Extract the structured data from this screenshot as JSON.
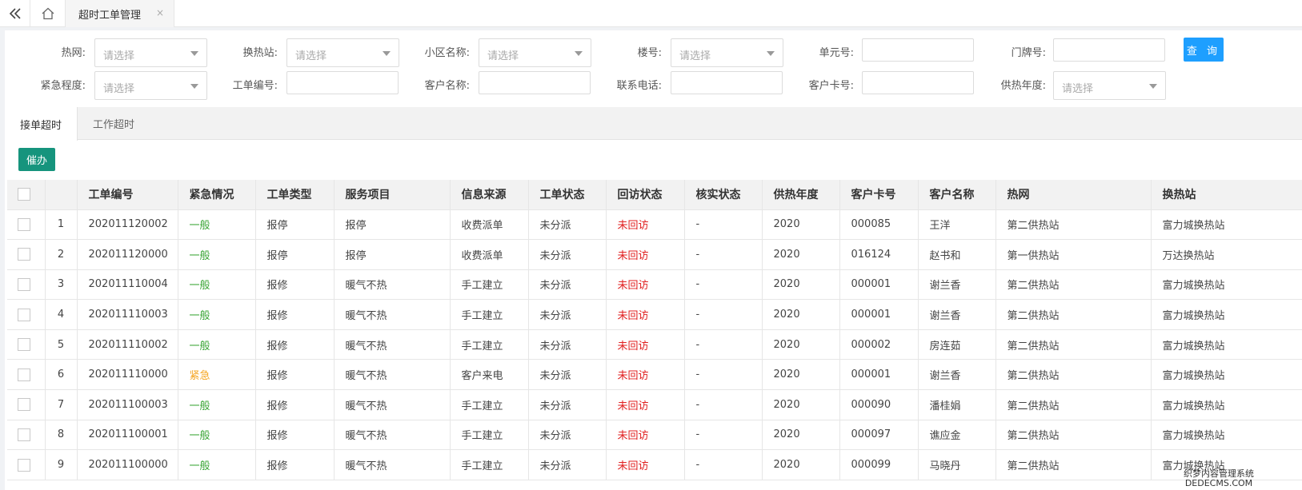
{
  "topbar": {
    "tab_label": "超时工单管理",
    "close_glyph": "×"
  },
  "filters": {
    "heat_net_label": "热网:",
    "station_label": "换热站:",
    "community_label": "小区名称:",
    "building_label": "楼号:",
    "unit_label": "单元号:",
    "door_label": "门牌号:",
    "urgency_label": "紧急程度:",
    "order_no_label": "工单编号:",
    "customer_name_label": "客户名称:",
    "phone_label": "联系电话:",
    "card_no_label": "客户卡号:",
    "year_label": "供热年度:",
    "select_placeholder": "请选择",
    "query_button": "查 询"
  },
  "tabs": [
    {
      "label": "接单超时",
      "active": true
    },
    {
      "label": "工作超时",
      "active": false
    }
  ],
  "urge_button": "催办",
  "table": {
    "columns": [
      "工单编号",
      "紧急情况",
      "工单类型",
      "服务项目",
      "信息来源",
      "工单状态",
      "回访状态",
      "核实状态",
      "供热年度",
      "客户卡号",
      "客户名称",
      "热网",
      "换热站"
    ],
    "rows": [
      {
        "no": "1",
        "order": "202011120002",
        "urgency": "一般",
        "urgent": false,
        "type": "报停",
        "item": "报停",
        "source": "收费派单",
        "status": "未分派",
        "visit": "未回访",
        "verify": "-",
        "year": "2020",
        "card": "000085",
        "name": "王洋",
        "net": "第二供热站",
        "station": "富力城换热站"
      },
      {
        "no": "2",
        "order": "202011120000",
        "urgency": "一般",
        "urgent": false,
        "type": "报停",
        "item": "报停",
        "source": "收费派单",
        "status": "未分派",
        "visit": "未回访",
        "verify": "-",
        "year": "2020",
        "card": "016124",
        "name": "赵书和",
        "net": "第一供热站",
        "station": "万达换热站"
      },
      {
        "no": "3",
        "order": "202011110004",
        "urgency": "一般",
        "urgent": false,
        "type": "报修",
        "item": "暖气不热",
        "source": "手工建立",
        "status": "未分派",
        "visit": "未回访",
        "verify": "-",
        "year": "2020",
        "card": "000001",
        "name": "谢兰香",
        "net": "第二供热站",
        "station": "富力城换热站"
      },
      {
        "no": "4",
        "order": "202011110003",
        "urgency": "一般",
        "urgent": false,
        "type": "报修",
        "item": "暖气不热",
        "source": "手工建立",
        "status": "未分派",
        "visit": "未回访",
        "verify": "-",
        "year": "2020",
        "card": "000001",
        "name": "谢兰香",
        "net": "第二供热站",
        "station": "富力城换热站"
      },
      {
        "no": "5",
        "order": "202011110002",
        "urgency": "一般",
        "urgent": false,
        "type": "报修",
        "item": "暖气不热",
        "source": "手工建立",
        "status": "未分派",
        "visit": "未回访",
        "verify": "-",
        "year": "2020",
        "card": "000002",
        "name": "房连茹",
        "net": "第二供热站",
        "station": "富力城换热站"
      },
      {
        "no": "6",
        "order": "202011110000",
        "urgency": "紧急",
        "urgent": true,
        "type": "报修",
        "item": "暖气不热",
        "source": "客户来电",
        "status": "未分派",
        "visit": "未回访",
        "verify": "-",
        "year": "2020",
        "card": "000001",
        "name": "谢兰香",
        "net": "第二供热站",
        "station": "富力城换热站"
      },
      {
        "no": "7",
        "order": "202011100003",
        "urgency": "一般",
        "urgent": false,
        "type": "报修",
        "item": "暖气不热",
        "source": "手工建立",
        "status": "未分派",
        "visit": "未回访",
        "verify": "-",
        "year": "2020",
        "card": "000090",
        "name": "潘桂娟",
        "net": "第二供热站",
        "station": "富力城换热站"
      },
      {
        "no": "8",
        "order": "202011100001",
        "urgency": "一般",
        "urgent": false,
        "type": "报修",
        "item": "暖气不热",
        "source": "手工建立",
        "status": "未分派",
        "visit": "未回访",
        "verify": "-",
        "year": "2020",
        "card": "000097",
        "name": "谯应金",
        "net": "第二供热站",
        "station": "富力城换热站"
      },
      {
        "no": "9",
        "order": "202011100000",
        "urgency": "一般",
        "urgent": false,
        "type": "报修",
        "item": "暖气不热",
        "source": "手工建立",
        "status": "未分派",
        "visit": "未回访",
        "verify": "-",
        "year": "2020",
        "card": "000099",
        "name": "马晓丹",
        "net": "第二供热站",
        "station": "富力城换热站"
      }
    ]
  },
  "watermark": {
    "line1": "织梦内容管理系统",
    "line2": "DEDECMS.COM"
  },
  "icons": {
    "back": "double-chevron-left-icon",
    "home": "home-icon",
    "caret": "caret-down-icon"
  },
  "colors": {
    "query_button": "#1e9fff",
    "urge_button": "#16947d",
    "urgency_normal": "#3aa535",
    "urgency_urgent": "#f5a623",
    "visit_pending": "#e02020"
  }
}
